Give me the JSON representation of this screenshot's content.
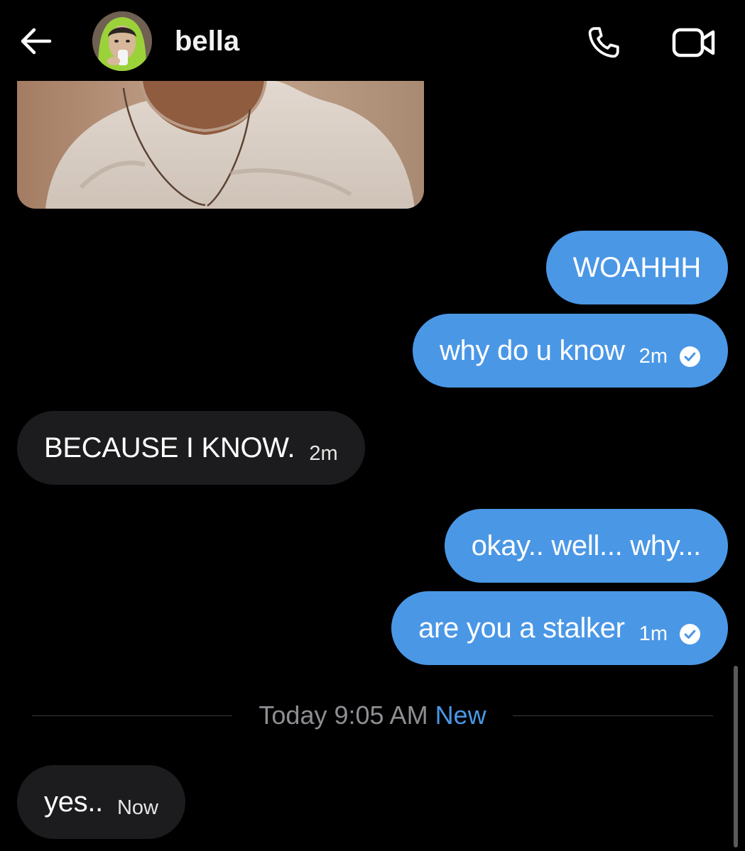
{
  "header": {
    "contact_name": "bella",
    "back_icon": "arrow-left-icon",
    "call_icon": "phone-icon",
    "video_icon": "video-camera-icon"
  },
  "colors": {
    "background": "#000000",
    "sent_bubble": "#4a97e6",
    "received_bubble": "#1c1c1e",
    "accent": "#4a97e6",
    "divider_text": "#8e8e93"
  },
  "messages": [
    {
      "type": "image",
      "direction": "received"
    },
    {
      "direction": "sent",
      "text": "WOAHHH"
    },
    {
      "direction": "sent",
      "text": "why do u know",
      "time": "2m",
      "status_icon": "read-check-icon"
    },
    {
      "direction": "received",
      "text": "BECAUSE I KNOW.",
      "time": "2m"
    },
    {
      "direction": "sent",
      "text": "okay.. well... why..."
    },
    {
      "direction": "sent",
      "text": "are you a stalker",
      "time": "1m",
      "status_icon": "read-check-icon"
    }
  ],
  "divider": {
    "time": "Today 9:05 AM",
    "new_label": "New"
  },
  "new_messages": [
    {
      "direction": "received",
      "text": "yes..",
      "time": "Now"
    }
  ]
}
